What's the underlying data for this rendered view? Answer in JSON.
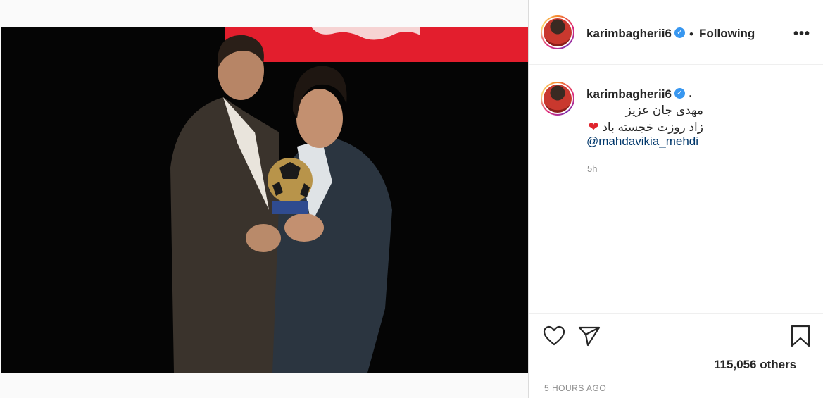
{
  "post": {
    "author": {
      "username": "karimbagherii6",
      "verified": true,
      "follow_separator": "•",
      "follow_status": "Following",
      "more_label": "•••"
    },
    "caption": {
      "username": "karimbagherii6",
      "dot": ".",
      "line1": "مهدی جان عزیز",
      "line2": "زاد روزت خجسته باد",
      "heart": "❤",
      "mention": "@mahdavikia_mehdi",
      "time": "5h"
    },
    "actions": {
      "like_icon": "heart-outline-icon",
      "share_icon": "paper-plane-icon",
      "save_icon": "bookmark-icon"
    },
    "likes_text": "115,056 others",
    "date_text": "5 HOURS AGO"
  },
  "colors": {
    "text": "#262626",
    "secondary": "#8e8e8e",
    "link": "#00376b",
    "verified": "#3897f0",
    "photo_background": "#050505",
    "banner_red": "#e31e2d"
  }
}
